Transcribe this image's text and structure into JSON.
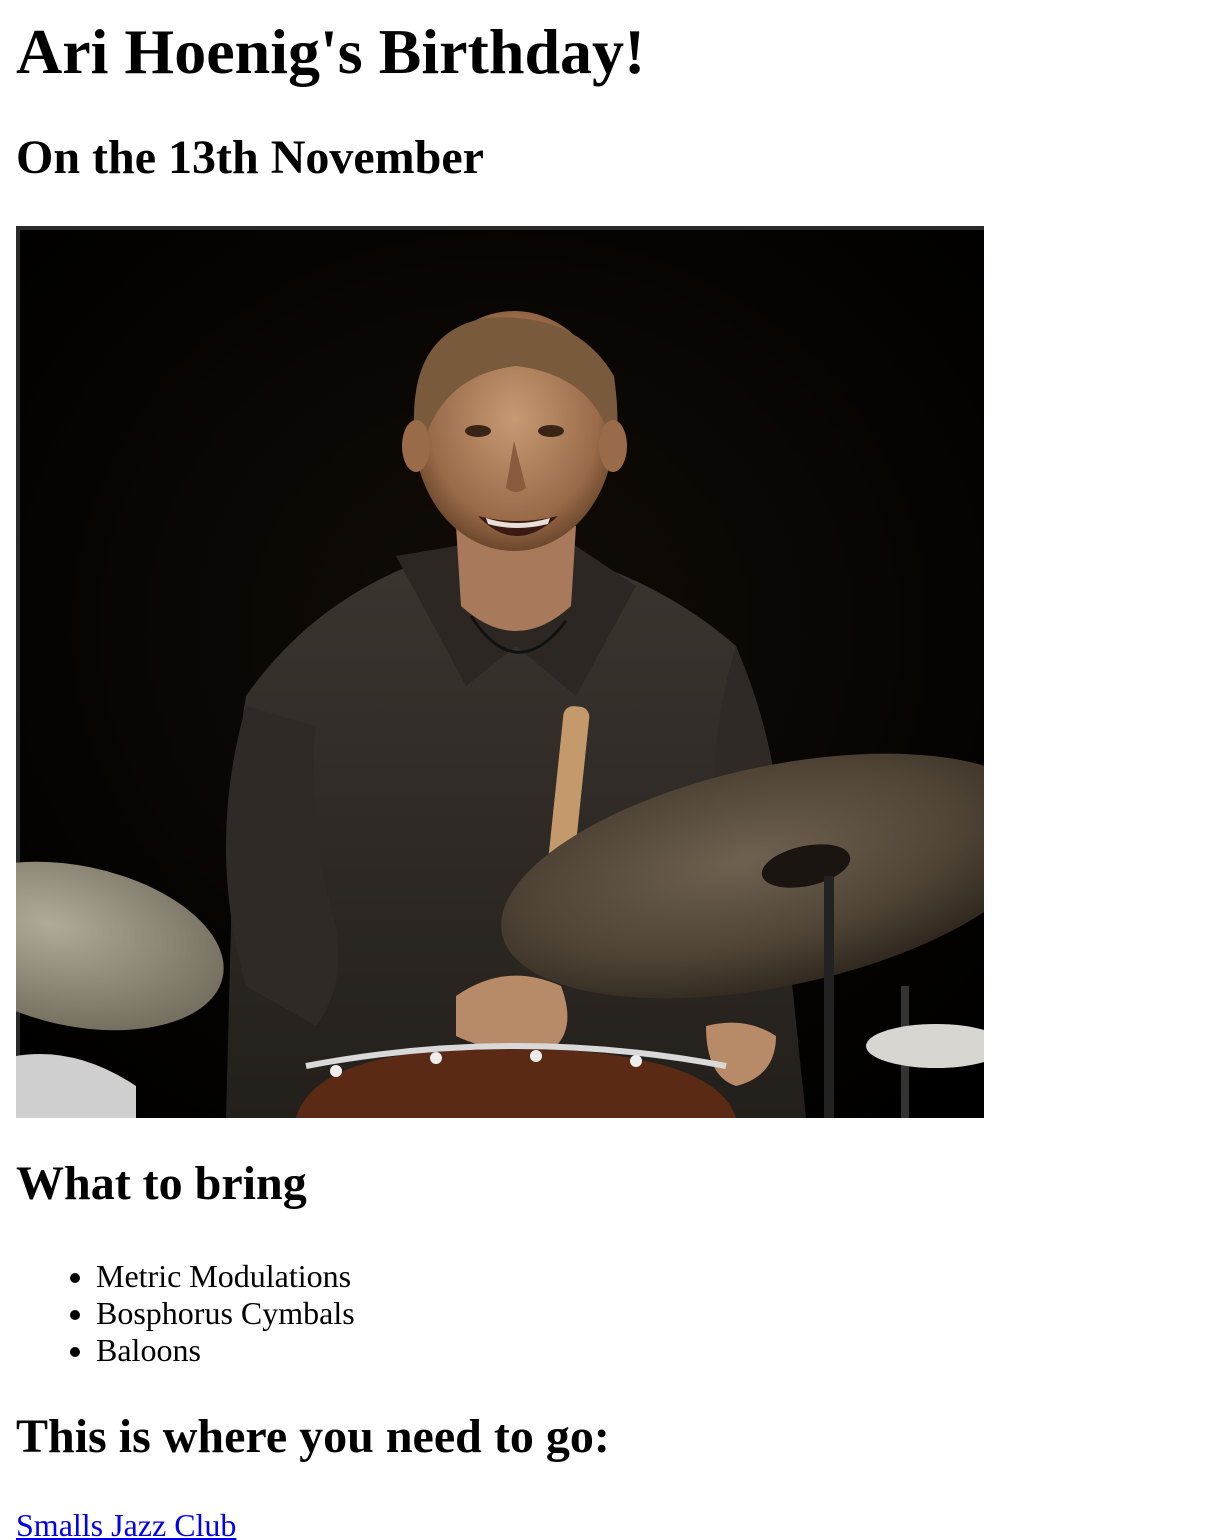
{
  "page": {
    "title": "Ari Hoenig's Birthday!",
    "subtitle": "On the 13th November"
  },
  "photo": {
    "alt": "Drummer smiling behind a drum kit with cymbals"
  },
  "bring": {
    "heading": "What to bring",
    "items": [
      "Metric Modulations",
      "Bosphorus Cymbals",
      "Baloons"
    ]
  },
  "location": {
    "heading": "This is where you need to go:",
    "link_label": "Smalls Jazz Club"
  },
  "colors": {
    "link": "#0000ee",
    "text": "#000000",
    "background": "#ffffff"
  }
}
